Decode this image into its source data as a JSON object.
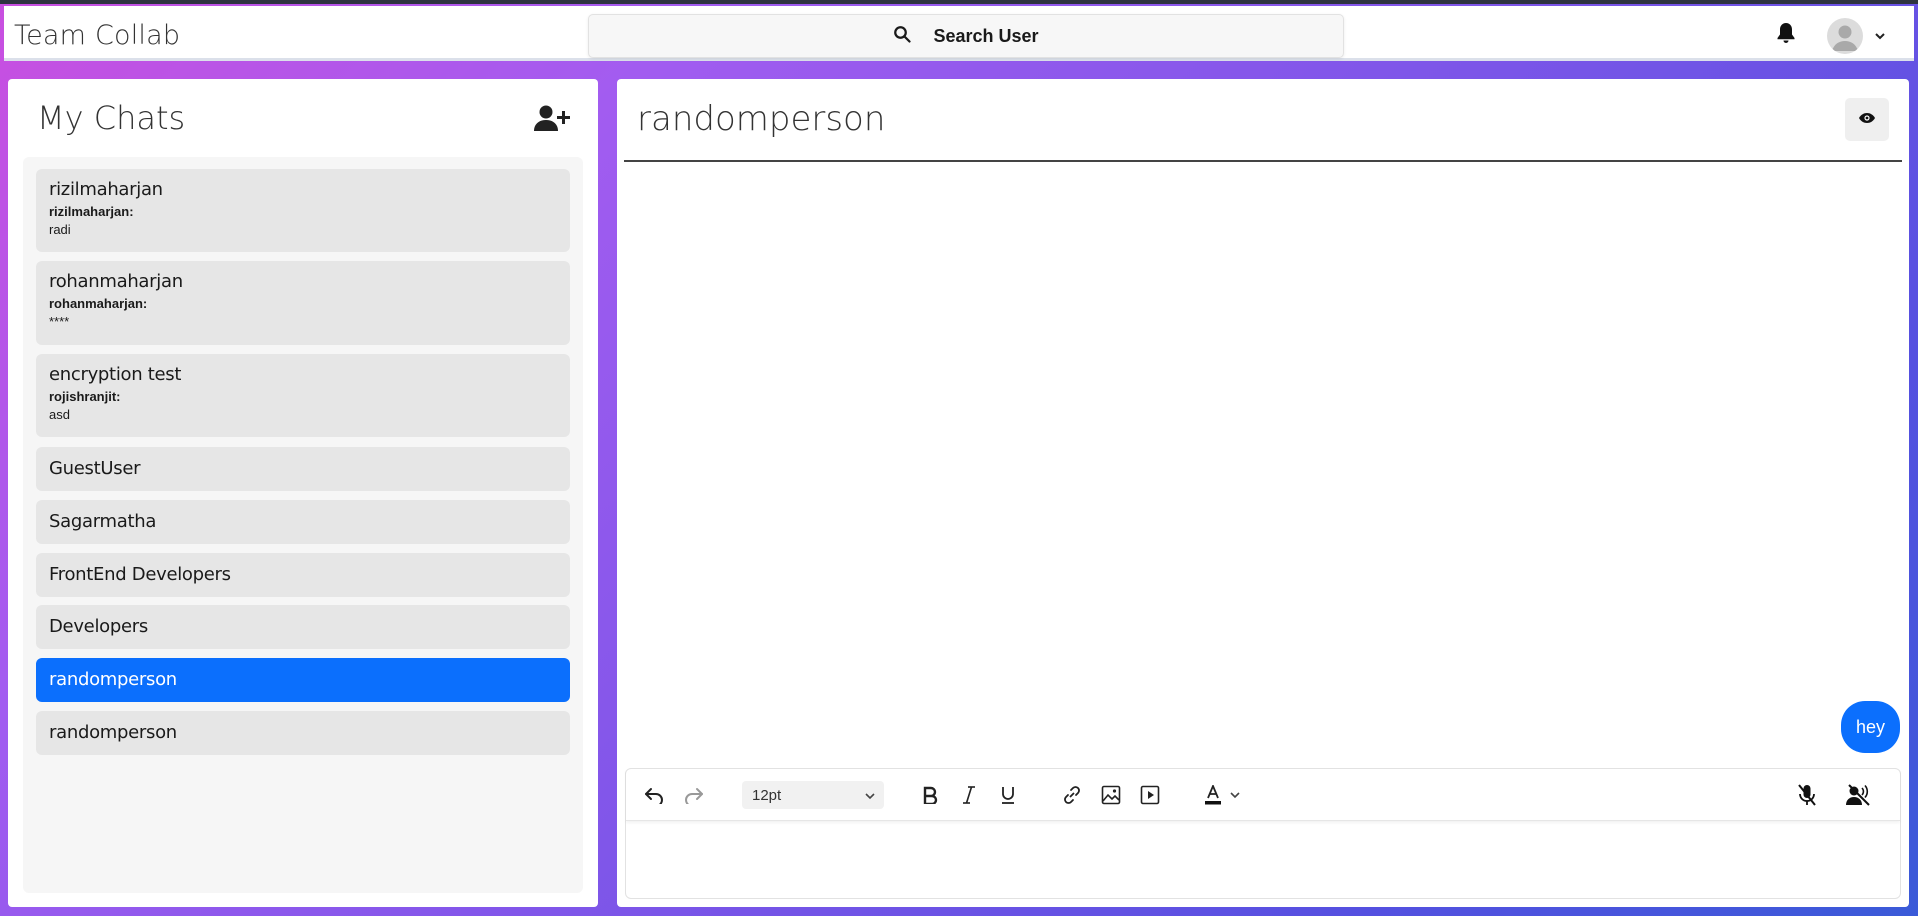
{
  "app": {
    "brand": "Team Collab"
  },
  "header": {
    "search_label": "Search User"
  },
  "sidebar": {
    "title": "My Chats",
    "chats": [
      {
        "name": "rizilmaharjan",
        "sender": "rizilmaharjan:",
        "message": "radi"
      },
      {
        "name": "rohanmaharjan",
        "sender": "rohanmaharjan:",
        "message": "****"
      },
      {
        "name": "encryption test",
        "sender": "rojishranjit:",
        "message": "asd"
      },
      {
        "name": "GuestUser"
      },
      {
        "name": "Sagarmatha"
      },
      {
        "name": "FrontEnd Developers"
      },
      {
        "name": "Developers"
      },
      {
        "name": "randomperson",
        "active": true
      },
      {
        "name": "randomperson"
      }
    ]
  },
  "conversation": {
    "title": "randomperson",
    "messages": [
      {
        "text": "hey",
        "own": true
      }
    ]
  },
  "editor": {
    "font_size": "12pt",
    "tools": [
      "undo-icon",
      "redo-icon",
      "bold-icon",
      "italic-icon",
      "underline-icon",
      "link-icon",
      "image-icon",
      "media-icon",
      "text-color-icon",
      "mic-off-icon",
      "voice-off-icon"
    ]
  },
  "colors": {
    "accent": "#0b6ffd",
    "chip": "#e6e6e6",
    "list_bg": "#f6f6f6"
  }
}
